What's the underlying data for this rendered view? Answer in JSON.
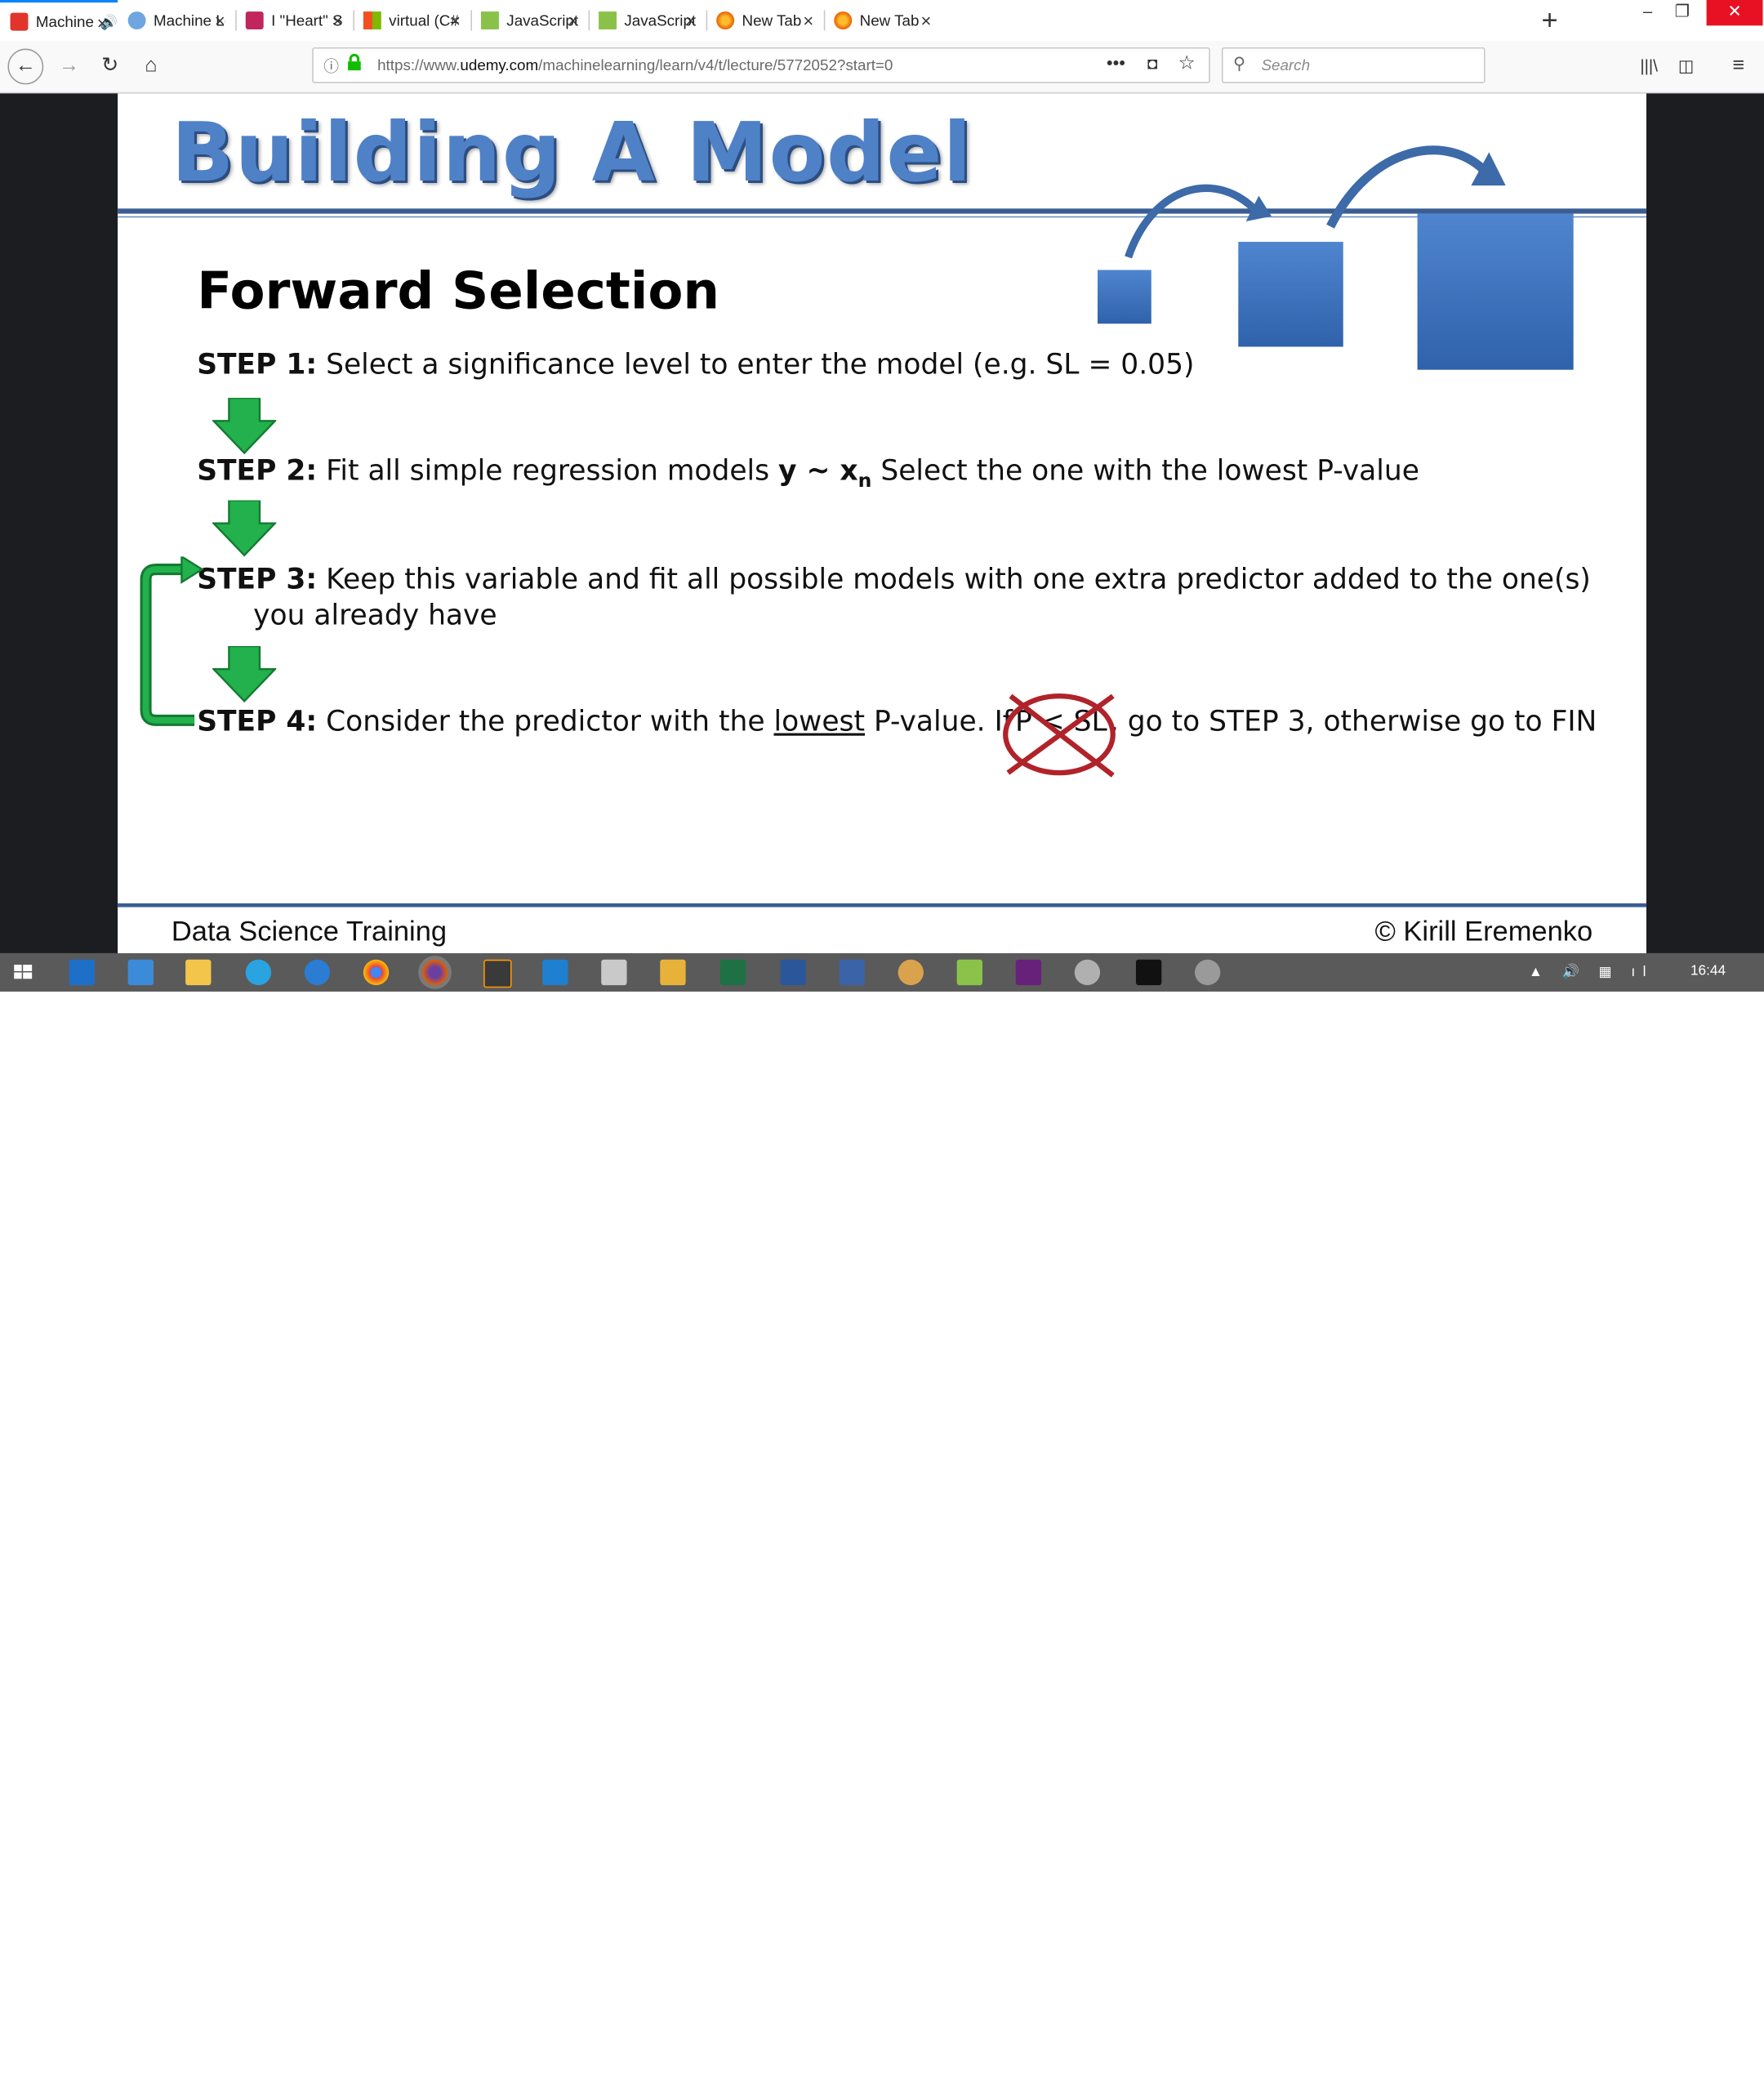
{
  "browser": {
    "tabs": [
      {
        "label": "Machine Lea",
        "active": true,
        "favicon": "udemy-icon",
        "color": "#e0342d",
        "audio": "speaker-icon"
      },
      {
        "label": "Machine Learnin",
        "favicon": "chat-icon",
        "color": "#6fa6e0"
      },
      {
        "label": "I \"Heart\" Stats: L",
        "favicon": "edx-icon",
        "color": "#c0255b"
      },
      {
        "label": "virtual (C# Refer",
        "favicon": "microsoft-icon",
        "color": "#f25022"
      },
      {
        "label": "JavaScript parseI",
        "favicon": "w3schools-icon",
        "color": "#8ac249"
      },
      {
        "label": "JavaScript Numb",
        "favicon": "w3schools-icon",
        "color": "#8ac249"
      },
      {
        "label": "New Tab",
        "favicon": "firefox-icon",
        "color": "#e66000"
      },
      {
        "label": "New Tab",
        "favicon": "firefox-icon",
        "color": "#e66000"
      }
    ],
    "url": {
      "prefix": "https://www.",
      "domain": "udemy.com",
      "path": "/machinelearning/learn/v4/t/lecture/5772052?start=0"
    },
    "search_placeholder": "Search"
  },
  "slide": {
    "title": "Building A Model",
    "heading": "Forward Selection",
    "steps": [
      {
        "label": "STEP 1:",
        "text": "Select a significance level to enter the model (e.g. SL = 0.05)"
      },
      {
        "label": "STEP 2:",
        "text_a": "Fit all simple regression models",
        "formula": "y ~ x",
        "sub": "n",
        "text_b": "Select the one with the lowest P-value"
      },
      {
        "label": "STEP 3:",
        "line1": "Keep this variable and fit all possible models with one extra predictor added to the one(s)",
        "line2": "you already have"
      },
      {
        "label": "STEP 4:",
        "text_a": "Consider the predictor with the",
        "underlined": "lowest",
        "text_b": "P-value. If",
        "condition": "P < SL",
        "text_c": ", go to STEP 3, otherwise go to FIN"
      }
    ],
    "footer_left": "Data Science Training",
    "footer_right": "© Kirill Eremenko"
  },
  "taskbar": {
    "clock": "16:44",
    "apps": [
      "windows-start-icon",
      "outlook-icon",
      "remote-desktop-icon",
      "file-explorer-icon",
      "skype-icon",
      "edge-icon",
      "chrome-icon",
      "firefox-icon",
      "sublime-icon",
      "vscode-icon",
      "printer-icon",
      "folder-icon",
      "excel-icon",
      "word-icon",
      "mail-icon",
      "paint-icon",
      "notepadpp-icon",
      "visual-studio-icon",
      "settings-icon",
      "terminal-icon",
      "spotify-icon"
    ]
  },
  "colors": {
    "accent": "#0a84ff",
    "slide_blue": "#4f81c7",
    "arrow_green": "#22b14c",
    "cross_red": "#b0232a"
  }
}
